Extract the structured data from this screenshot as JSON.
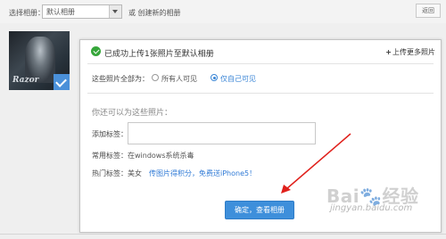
{
  "topbar": {
    "album_label": "选择相册：",
    "album_value": "默认相册",
    "create_link": "或 创建新的相册",
    "right_button": "返回"
  },
  "thumbnail": {
    "logo_text": "Razor"
  },
  "dialog": {
    "title": "已成功上传1张照片至默认相册",
    "more_link": "上传更多照片",
    "permission": {
      "label": "这些照片全部为：",
      "options": [
        "所有人可见",
        "仅自己可见"
      ],
      "selected": "仅自己可见"
    },
    "sub_heading": "你还可以为这些照片：",
    "tag_label": "添加标签：",
    "tag_input_value": "",
    "common_label": "常用标签：",
    "common_value": "在windows系统杀毒",
    "hot_label": "热门标签：",
    "hot_tag": "美女",
    "hot_link": "传图片得积分，免费送iPhone5！",
    "confirm_button": "确定，查看相册"
  },
  "watermark": {
    "logo": "Bai🐾经验",
    "url": "jingyan.baidu.com"
  },
  "colors": {
    "accent": "#3e8fdb",
    "success": "#36a63a",
    "annotation": "#e0201b"
  }
}
